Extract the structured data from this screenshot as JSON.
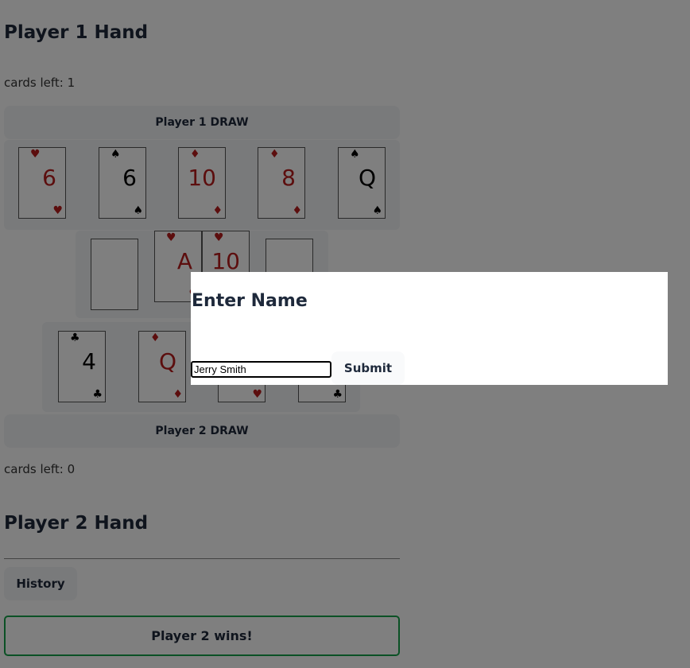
{
  "player1": {
    "title": "Player 1 Hand",
    "cards_left": "cards left: 1",
    "draw_label": "Player 1 DRAW",
    "hand": [
      {
        "rank": "6",
        "suit": "♥",
        "color": "red"
      },
      {
        "rank": "6",
        "suit": "♠",
        "color": "black"
      },
      {
        "rank": "10",
        "suit": "♦",
        "color": "red"
      },
      {
        "rank": "8",
        "suit": "♦",
        "color": "red"
      },
      {
        "rank": "Q",
        "suit": "♠",
        "color": "black"
      }
    ]
  },
  "table": {
    "piles": [
      {
        "rank": "",
        "suit": "",
        "color": "blank"
      },
      {
        "rank": "A",
        "suit": "♥",
        "color": "red"
      },
      {
        "rank": "10",
        "suit": "♥",
        "color": "red"
      },
      {
        "rank": "",
        "suit": "",
        "color": "blank"
      }
    ]
  },
  "player2": {
    "title": "Player 2 Hand",
    "cards_left": "cards left: 0",
    "draw_label": "Player 2 DRAW",
    "hand": [
      {
        "rank": "4",
        "suit": "♣",
        "color": "black"
      },
      {
        "rank": "Q",
        "suit": "♦",
        "color": "red"
      },
      {
        "rank": "",
        "suit": "♥",
        "color": "red"
      },
      {
        "rank": "",
        "suit": "♣",
        "color": "black"
      }
    ]
  },
  "history_label": "History",
  "winner_text": "Player 2 wins!",
  "modal": {
    "title": "Enter Name",
    "input_value": "Jerry Smith",
    "submit_label": "Submit"
  },
  "colors": {
    "red_suit": "#b91c1c",
    "black_suit": "#000000",
    "button_bg": "#f3f4f6",
    "winner_border": "#16a34a",
    "overlay": "rgba(0,0,0,0.5)"
  }
}
